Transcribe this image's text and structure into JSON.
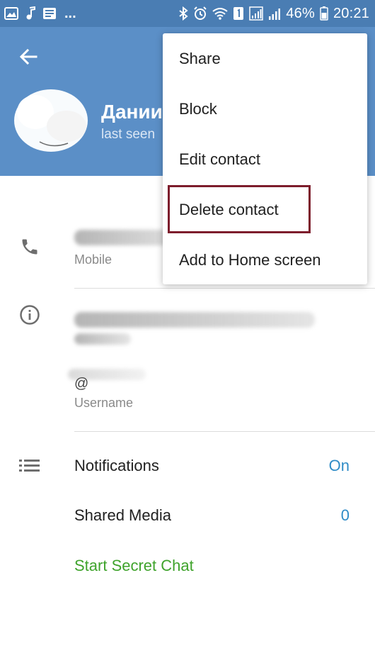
{
  "status_bar": {
    "battery_percent": "46%",
    "time": "20:21",
    "overflow": "...",
    "left_icons": [
      "gallery-icon",
      "music-note-icon",
      "inbox-icon"
    ],
    "right_icons": [
      "bluetooth-icon",
      "alarm-icon",
      "wifi-icon",
      "sim-1-icon",
      "signal-icon",
      "signal-icon",
      "battery-icon"
    ],
    "background": "#4a7db3"
  },
  "header": {
    "name": "Дании",
    "status": "last seen",
    "background": "#5b8fc7"
  },
  "info": {
    "phone_label": "Mobile",
    "username_label": "Username",
    "username_prefix": "@"
  },
  "settings": {
    "notifications_label": "Notifications",
    "notifications_value": "On",
    "shared_media_label": "Shared Media",
    "shared_media_value": "0",
    "secret_chat_label": "Start Secret Chat"
  },
  "menu": {
    "items": [
      "Share",
      "Block",
      "Edit contact",
      "Delete contact",
      "Add to Home screen"
    ],
    "highlighted": "Delete contact"
  },
  "colors": {
    "accent": "#2f8cc7",
    "secret_chat": "#3fa32c",
    "highlight_border": "#7d1d2c"
  }
}
